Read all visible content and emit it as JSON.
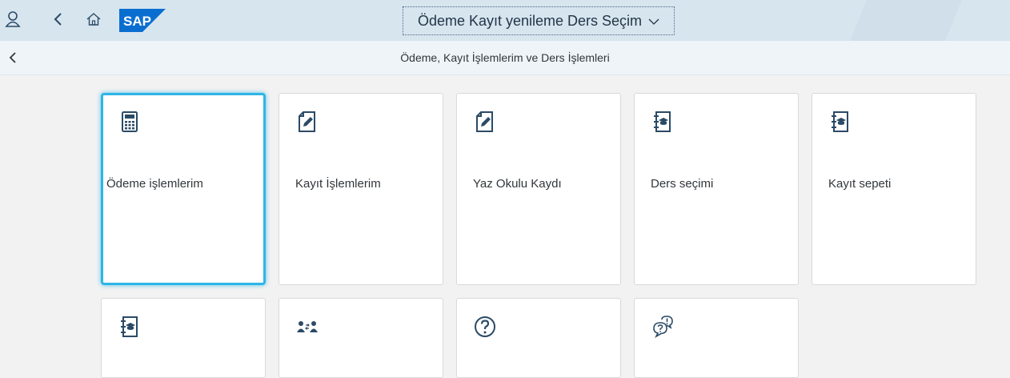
{
  "shell": {
    "title": "Ödeme Kayıt yenileme Ders Seçim",
    "logo_text": "SAP",
    "colors": {
      "shell_bg": "#d7e5ef",
      "logo_blue": "#0a6ed1",
      "focus": "#2fb5e6",
      "icon": "#2b4a66"
    }
  },
  "header": {
    "title": "Ödeme, Kayıt İşlemlerim ve Ders İşlemleri"
  },
  "tiles": [
    {
      "label": "Ödeme işlemlerim",
      "icon": "calculator-icon"
    },
    {
      "label": "Kayıt İşlemlerim",
      "icon": "edit-document-icon"
    },
    {
      "label": "Yaz Okulu Kaydı",
      "icon": "edit-document-icon"
    },
    {
      "label": "Ders seçimi",
      "icon": "course-book-icon"
    },
    {
      "label": "Kayıt sepeti",
      "icon": "course-book-icon"
    },
    {
      "label": "",
      "icon": "course-book-icon"
    },
    {
      "label": "",
      "icon": "group-exchange-icon"
    },
    {
      "label": "",
      "icon": "question-mark-icon"
    },
    {
      "label": "",
      "icon": "discussion-icon"
    }
  ]
}
